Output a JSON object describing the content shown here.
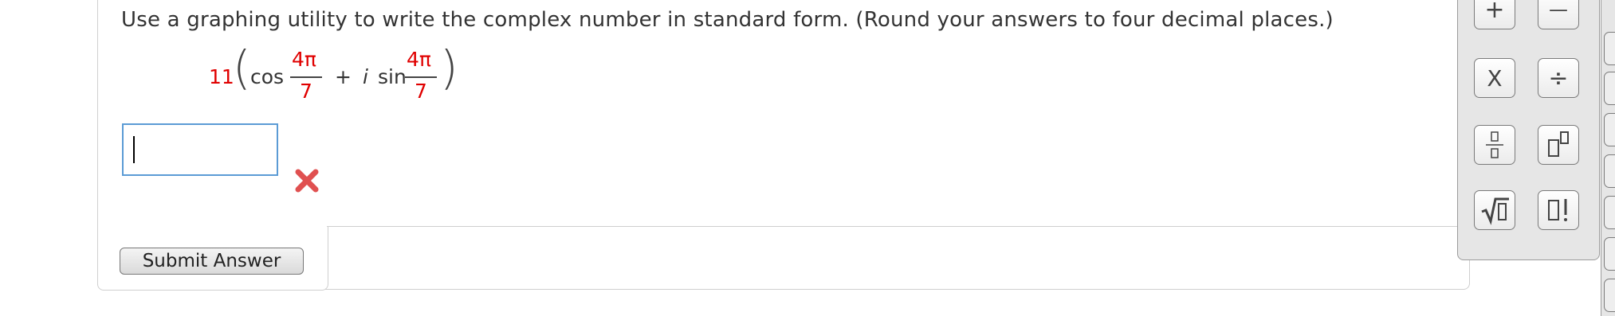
{
  "question": {
    "prompt": "Use a graphing utility to write the complex number in standard form. (Round your answers to four decimal places.)",
    "expression": {
      "coefficient": "11",
      "cos_label": "cos",
      "numerator": "4π",
      "denominator": "7",
      "plus": "+",
      "imag_unit": "i",
      "sin_label": "sin",
      "numerator2": "4π",
      "denominator2": "7"
    },
    "answer": {
      "value": "",
      "status": "incorrect"
    },
    "submit_label": "Submit Answer"
  },
  "palette": {
    "buttons": [
      {
        "name": "plus",
        "label": "+"
      },
      {
        "name": "minus",
        "label": "—"
      },
      {
        "name": "times",
        "label": "X"
      },
      {
        "name": "divide",
        "label": "÷"
      },
      {
        "name": "fraction",
        "label": "▯/▯"
      },
      {
        "name": "power",
        "label": "▯▯"
      },
      {
        "name": "sqrt",
        "label": "√▯"
      },
      {
        "name": "factorial",
        "label": "▯!"
      }
    ]
  },
  "colors": {
    "accent_red": "#e00000",
    "input_border": "#5b9bd5",
    "wrong_icon": "#e05050"
  }
}
